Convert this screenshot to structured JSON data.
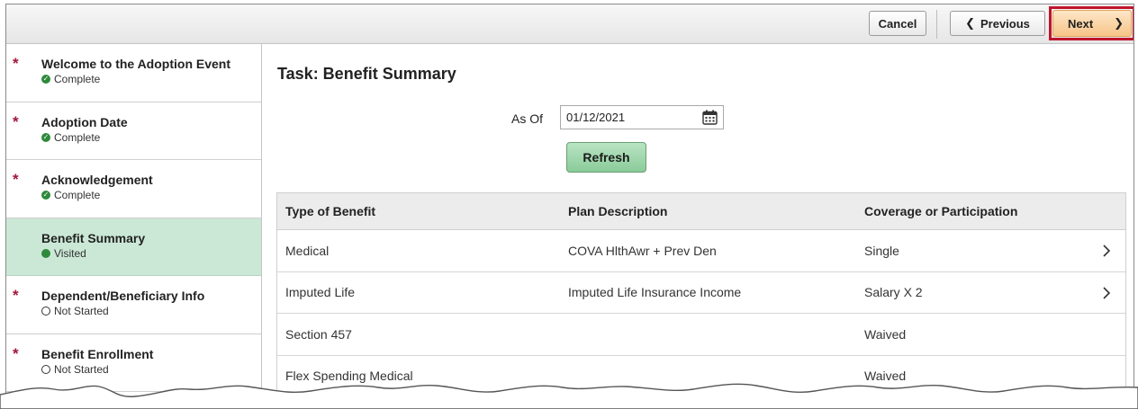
{
  "toolbar": {
    "cancel_label": "Cancel",
    "previous_label": "Previous",
    "next_label": "Next"
  },
  "sidebar": {
    "items": [
      {
        "title": "Welcome to the Adoption Event",
        "status": "Complete",
        "required": true
      },
      {
        "title": "Adoption Date",
        "status": "Complete",
        "required": true
      },
      {
        "title": "Acknowledgement",
        "status": "Complete",
        "required": true
      },
      {
        "title": "Benefit Summary",
        "status": "Visited",
        "required": false
      },
      {
        "title": "Dependent/Beneficiary Info",
        "status": "Not Started",
        "required": true
      },
      {
        "title": "Benefit Enrollment",
        "status": "Not Started",
        "required": true
      }
    ],
    "required_marker": "*"
  },
  "main": {
    "task_title": "Task: Benefit Summary",
    "as_of_label": "As Of",
    "as_of_value": "01/12/2021",
    "refresh_label": "Refresh",
    "table": {
      "headers": [
        "Type of Benefit",
        "Plan Description",
        "Coverage or Participation"
      ],
      "rows": [
        {
          "type": "Medical",
          "plan": "COVA HlthAwr + Prev Den",
          "coverage": "Single",
          "has_detail": true
        },
        {
          "type": "Imputed Life",
          "plan": "Imputed Life Insurance Income",
          "coverage": "Salary X 2",
          "has_detail": true
        },
        {
          "type": "Section 457",
          "plan": "",
          "coverage": "Waived",
          "has_detail": false
        },
        {
          "type": "Flex Spending Medical",
          "plan": "",
          "coverage": "Waived",
          "has_detail": false
        }
      ]
    }
  },
  "colors": {
    "highlight_outline": "#c0142c",
    "active_step_bg": "#cbe8d6",
    "required_star": "#a1173b",
    "status_green": "#2d8a3a",
    "refresh_button": "#8acb99",
    "next_button": "#f7c488"
  },
  "icons": {
    "calendar": "calendar-icon",
    "previous": "chevron-left-icon",
    "next": "chevron-right-icon",
    "complete": "check-circle-icon",
    "visited": "filled-circle-icon",
    "not_started": "empty-circle-icon",
    "row_detail": "chevron-right-icon"
  }
}
